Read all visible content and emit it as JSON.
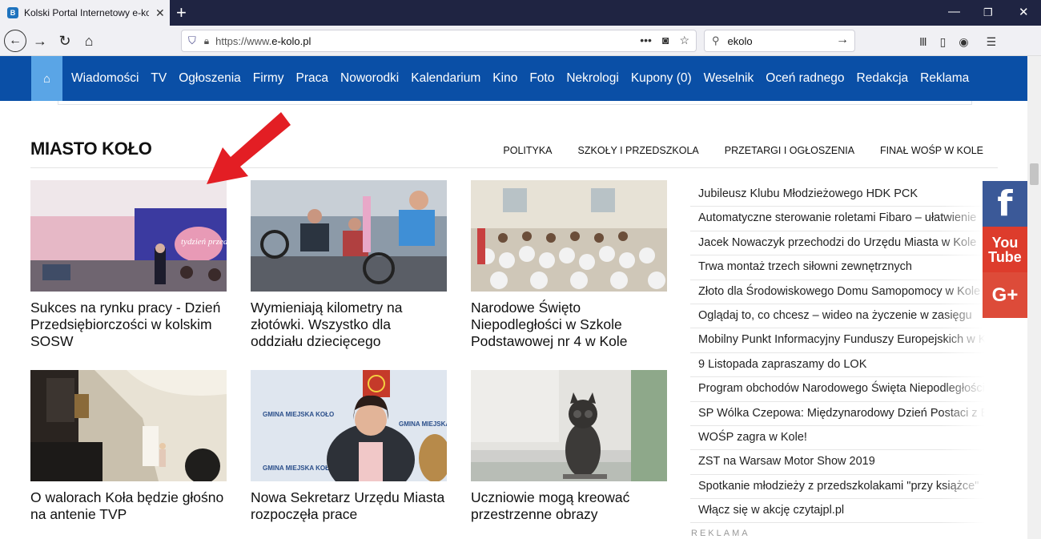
{
  "browser": {
    "tab_title": "Kolski Portal Internetowy e-kolo.pl",
    "favicon_letter": "B",
    "url_prefix": "https://www.",
    "url_domain": "e-kolo.pl",
    "search_query": "ekolo"
  },
  "site": {
    "menu": [
      "Wiadomości",
      "TV",
      "Ogłoszenia",
      "Firmy",
      "Praca",
      "Noworodki",
      "Kalendarium",
      "Kino",
      "Foto",
      "Nekrologi",
      "Kupony (0)",
      "Weselnik",
      "Oceń radnego",
      "Redakcja",
      "Reklama"
    ]
  },
  "section": {
    "title": "MIASTO KOŁO",
    "subnav": [
      "POLITYKA",
      "SZKOŁY I PRZEDSZKOLA",
      "PRZETARGI I OGŁOSZENIA",
      "FINAŁ WOŚP W KOLE"
    ]
  },
  "articles": [
    {
      "caption": "Sukces na rynku pracy - Dzień Przedsiębiorczości w kolskim SOSW",
      "banner_text": "tydzień przedsi"
    },
    {
      "caption": "Wymieniają kilometry na złotówki. Wszystko dla oddziału dziecięcego"
    },
    {
      "caption": "Narodowe Święto Niepodległości w Szkole Podstawowej nr 4 w Kole"
    },
    {
      "caption": "O walorach Koła będzie głośno na antenie TVP"
    },
    {
      "caption": "Nowa Sekretarz Urzędu Miasta rozpoczęła prace",
      "banner_text": "GMINA MIEJSKA KOŁO"
    },
    {
      "caption": "Uczniowie mogą kreować przestrzenne obrazy"
    }
  ],
  "headlines": [
    "Jubileusz Klubu Młodzieżowego HDK PCK",
    "Automatyczne sterowanie roletami Fibaro – ułatwienie",
    "Jacek Nowaczyk przechodzi do Urzędu Miasta w Kole",
    "Trwa montaż trzech siłowni zewnętrznych",
    "Złoto dla Środowiskowego Domu Samopomocy w Kole",
    "Oglądaj to, co chcesz – wideo na życzenie w zasięgu",
    "Mobilny Punkt Informacyjny Funduszy Europejskich w Kole",
    "9 Listopada zapraszamy do LOK",
    "Program obchodów Narodowego Święta Niepodległości",
    "SP Wólka Czepowa: Międzynarodowy Dzień Postaci z Bajek",
    "WOŚP zagra w Kole!",
    "ZST na Warsaw Motor Show 2019",
    "Spotkanie młodzieży z przedszkolakami \"przy książce\"",
    "Włącz się w akcję czytajpl.pl"
  ],
  "reklama_label": "REKLAMA",
  "social": {
    "fb": "f",
    "yt_top": "You",
    "yt_bottom": "Tube",
    "gp": "G+"
  },
  "colors": {
    "menu_bg": "#0a4fa6",
    "home_bg": "#5aa5e6",
    "arrow": "#e31e24"
  }
}
